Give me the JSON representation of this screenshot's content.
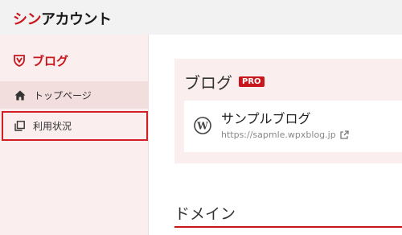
{
  "app": {
    "logo_accent": "シン",
    "logo_rest": "アカウント"
  },
  "sidebar": {
    "brand_label": "ブログ",
    "items": [
      {
        "label": "トップページ",
        "icon": "home-icon",
        "active": true
      },
      {
        "label": "利用状況",
        "icon": "copy-icon",
        "highlighted": true
      }
    ]
  },
  "main": {
    "blog_section": {
      "title": "ブログ",
      "badge": "PRO"
    },
    "site": {
      "name": "サンプルブログ",
      "url": "https://sapmle.wpxblog.jp",
      "icon": "wordpress-icon",
      "link_icon": "external-link-icon"
    },
    "domain_section": {
      "title": "ドメイン"
    }
  },
  "colors": {
    "accent": "#c8161d",
    "sidebar_bg": "#fbeeee",
    "topbar_bg": "#f2f2f2"
  }
}
